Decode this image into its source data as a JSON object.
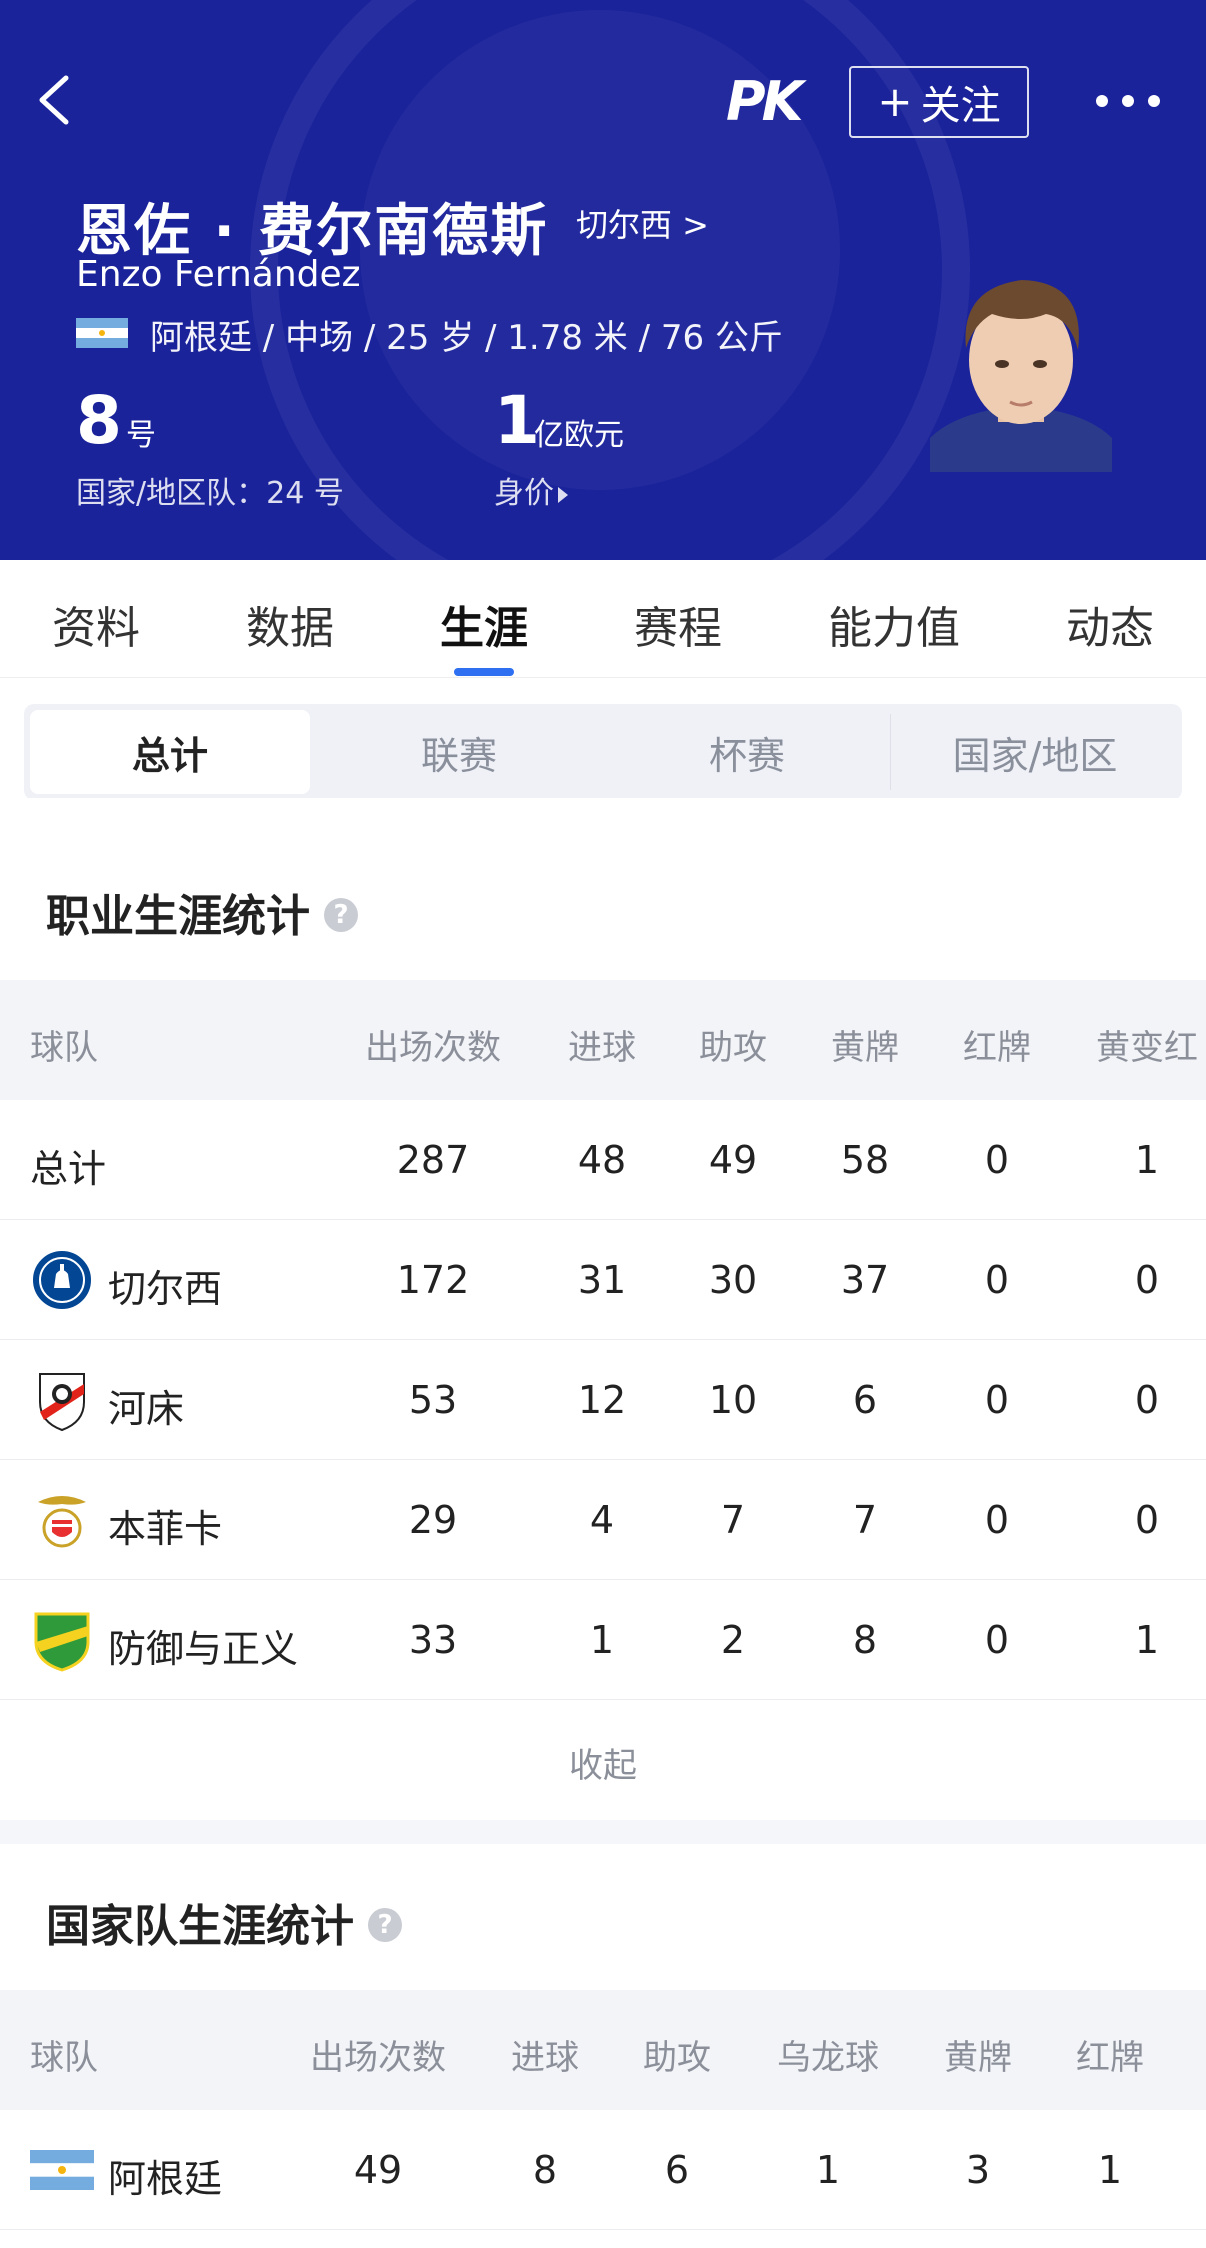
{
  "header": {
    "follow_label": "关注",
    "name_cn": "恩佐 · 费尔南德斯",
    "club_link": "切尔西 >",
    "name_en": "Enzo Fernández",
    "info_line": "阿根廷 / 中场 / 25 岁 / 1.78 米 / 76 公斤",
    "number": "8",
    "number_unit": "号",
    "national_number": "国家/地区队：24 号",
    "value": "1",
    "value_unit": "亿欧元",
    "value_label": "身价"
  },
  "tabs": [
    "资料",
    "数据",
    "生涯",
    "赛程",
    "能力值",
    "动态"
  ],
  "active_tab": "生涯",
  "segments": [
    "总计",
    "联赛",
    "杯赛",
    "国家/地区"
  ],
  "career": {
    "title": "职业生涯统计",
    "columns": [
      "球队",
      "出场次数",
      "进球",
      "助攻",
      "黄牌",
      "红牌",
      "黄变红"
    ],
    "rows": [
      {
        "team": "总计",
        "apps": "287",
        "goals": "48",
        "assists": "49",
        "yellow": "58",
        "red": "0",
        "second_yellow": "1"
      },
      {
        "team": "切尔西",
        "apps": "172",
        "goals": "31",
        "assists": "30",
        "yellow": "37",
        "red": "0",
        "second_yellow": "0"
      },
      {
        "team": "河床",
        "apps": "53",
        "goals": "12",
        "assists": "10",
        "yellow": "6",
        "red": "0",
        "second_yellow": "0"
      },
      {
        "team": "本菲卡",
        "apps": "29",
        "goals": "4",
        "assists": "7",
        "yellow": "7",
        "red": "0",
        "second_yellow": "0"
      },
      {
        "team": "防御与正义",
        "apps": "33",
        "goals": "1",
        "assists": "2",
        "yellow": "8",
        "red": "0",
        "second_yellow": "1"
      }
    ],
    "collapse_label": "收起"
  },
  "national": {
    "title": "国家队生涯统计",
    "columns": [
      "球队",
      "出场次数",
      "进球",
      "助攻",
      "乌龙球",
      "黄牌",
      "红牌"
    ],
    "rows": [
      {
        "team": "阿根廷",
        "apps": "49",
        "goals": "8",
        "assists": "6",
        "own_goals": "1",
        "yellow": "3",
        "red": "1"
      }
    ]
  },
  "colors": {
    "header_bg": "#1b239b",
    "accent": "#2f6ff2",
    "chelsea": "#034694",
    "river": "#e2231a",
    "benfica": "#e83030",
    "defensa": "#2e9a3a"
  }
}
